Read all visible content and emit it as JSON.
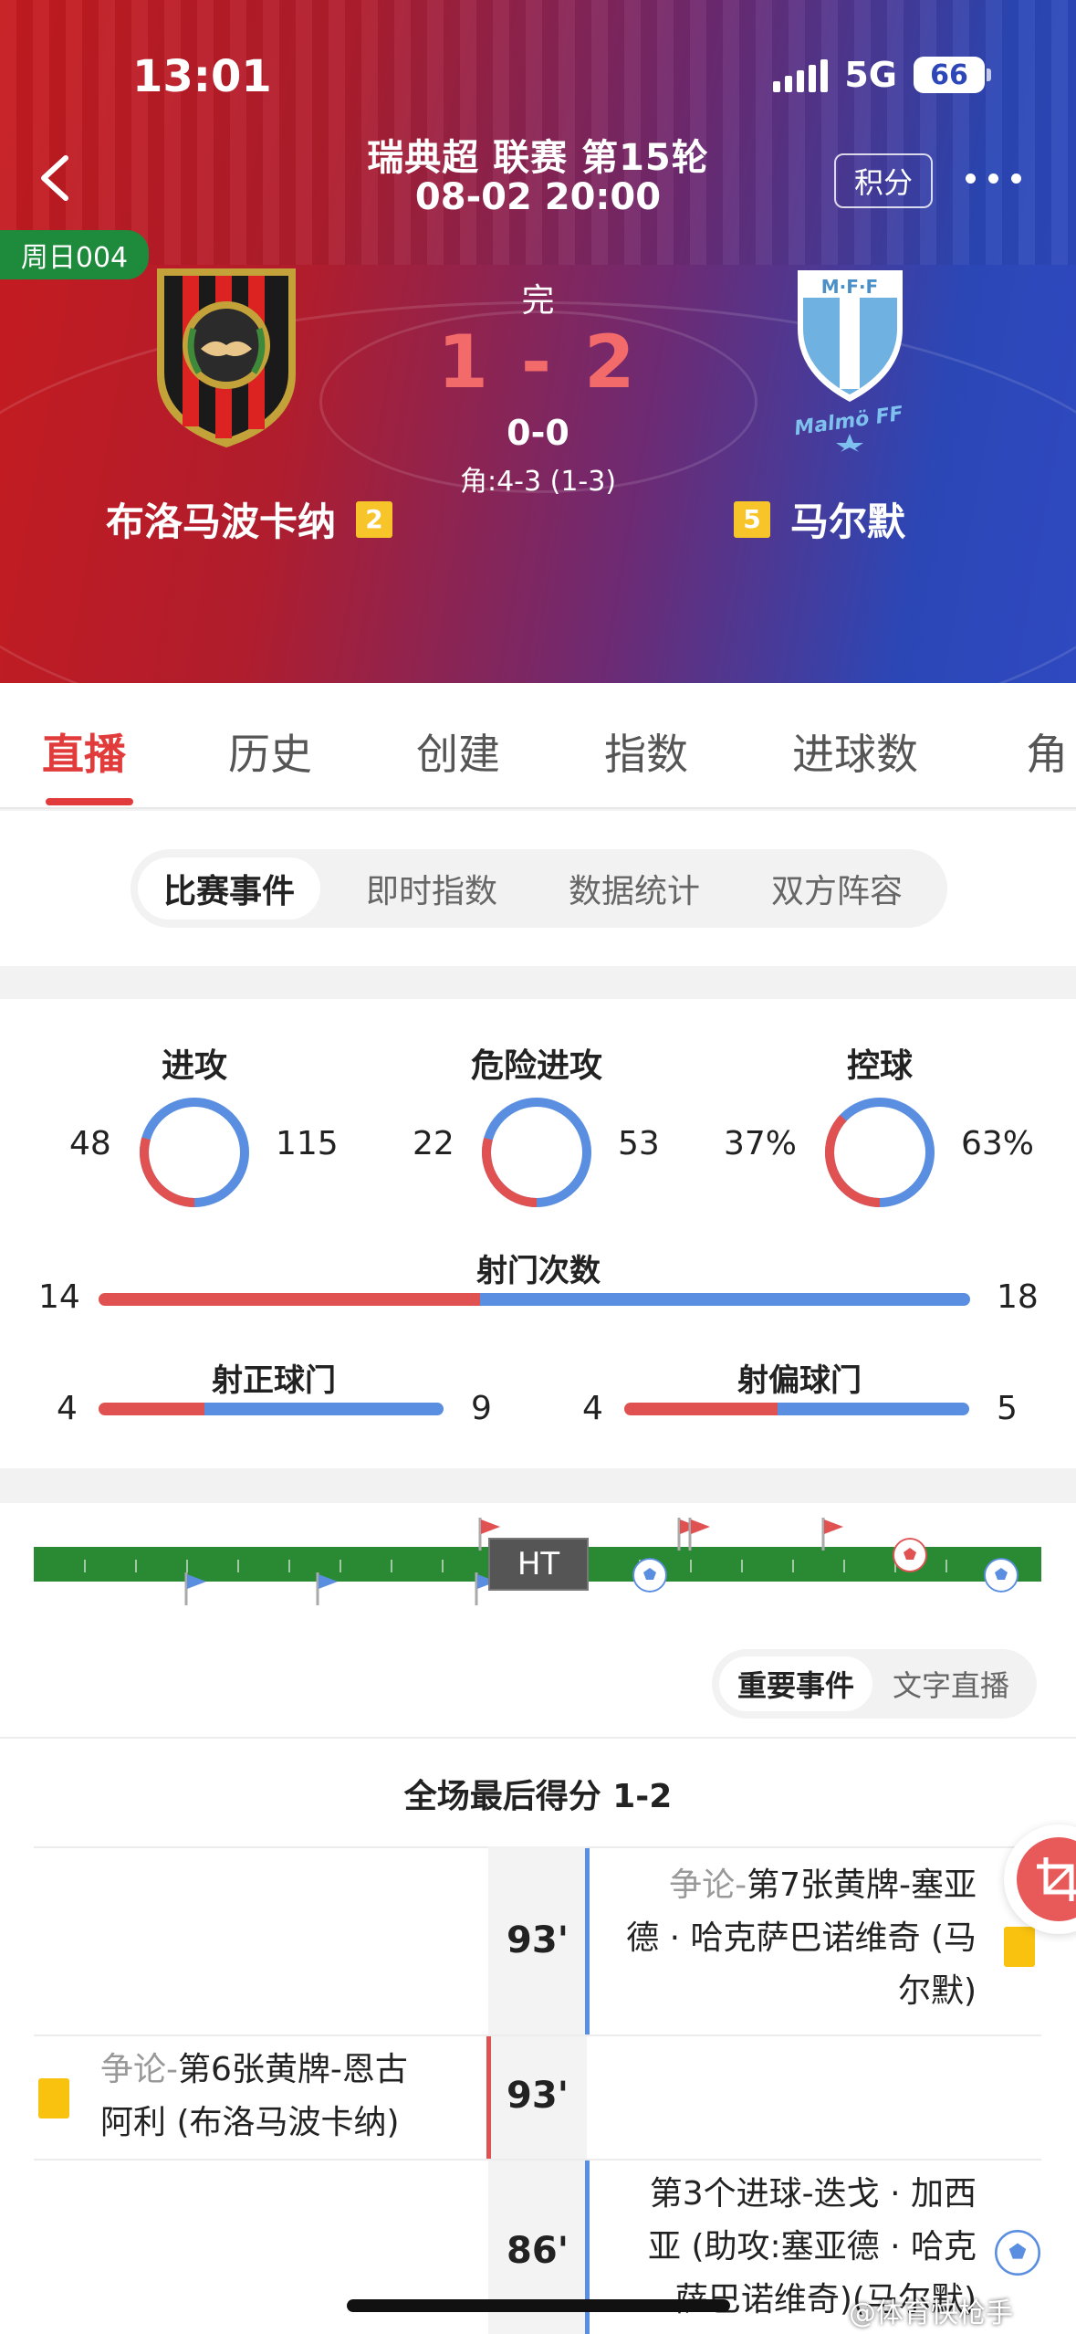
{
  "status_bar": {
    "time": "13:01",
    "network": "5G",
    "battery": "66"
  },
  "header": {
    "league": "瑞典超 联赛 第15轮",
    "datetime": "08-02 20:00",
    "points_label": "积分",
    "match_code": "周日004",
    "status": "完",
    "score": "1 - 2",
    "halftime": "0-0",
    "corners": "角:4-3 (1-3)",
    "home_team": {
      "name": "布洛马波卡纳",
      "rank": "2"
    },
    "away_team": {
      "name": "马尔默",
      "rank": "5"
    }
  },
  "tabs": [
    "直播",
    "历史",
    "创建",
    "指数",
    "进球数",
    "角"
  ],
  "active_tab": "直播",
  "sub_tabs": [
    "比赛事件",
    "即时指数",
    "数据统计",
    "双方阵容"
  ],
  "active_sub_tab": "比赛事件",
  "stats": {
    "rings": [
      {
        "title": "进攻",
        "home": "48",
        "away": "115",
        "home_frac": 0.294
      },
      {
        "title": "危险进攻",
        "home": "22",
        "away": "53",
        "home_frac": 0.293
      },
      {
        "title": "控球",
        "home": "37%",
        "away": "63%",
        "home_frac": 0.37
      }
    ],
    "shots": {
      "title": "射门次数",
      "home": "14",
      "away": "18",
      "home_frac": 0.4375
    },
    "on_target": {
      "title": "射正球门",
      "home": "4",
      "away": "9",
      "home_frac": 0.3077
    },
    "off_target": {
      "title": "射偏球门",
      "home": "4",
      "away": "5",
      "home_frac": 0.4444
    }
  },
  "timeline": {
    "ht_label": "HT",
    "toggle": [
      "重要事件",
      "文字直播"
    ],
    "active_toggle": "重要事件"
  },
  "events": {
    "final_score": "全场最后得分 1-2",
    "rows": [
      {
        "minute": "93'",
        "side": "away",
        "prefix": "争论-",
        "line1": "第7张黄牌-塞亚",
        "line2": "德 · 哈克萨巴诺维奇 (马",
        "line3": "尔默)"
      },
      {
        "minute": "93'",
        "side": "home",
        "prefix": "争论-",
        "line1": "第6张黄牌-恩古",
        "line2": "阿利 (布洛马波卡纳)"
      },
      {
        "minute": "86'",
        "side": "away",
        "line1": "第3个进球-迭戈 · 加西",
        "line2": "亚 (助攻:塞亚德 · 哈克",
        "line3": "萨巴诺维奇)(马尔默)"
      }
    ]
  },
  "watermark": "@体育快枪手",
  "colors": {
    "home_red": "#e05252",
    "away_blue": "#5a8ee0",
    "accent": "#e13b3b",
    "pitch_green": "#2a8a34"
  }
}
